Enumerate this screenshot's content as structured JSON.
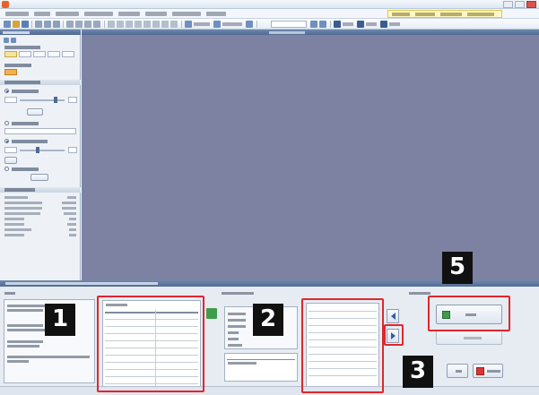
{
  "app": {
    "title": ""
  },
  "colors": {
    "viewer_background": "#7d82a3",
    "panel_header": "#4e6a94",
    "highlight": "#e0272b",
    "callout_background": "#111111",
    "help_box": "#fff7c9",
    "accent_orange": "#e8632b"
  },
  "icons": {
    "app_logo": "app-logo-icon",
    "arrow_left": "arrow-left-icon",
    "arrow_right": "arrow-right-icon",
    "ok_button_icon": "green-square-icon",
    "cancel_button_icon": "red-x-icon"
  },
  "callouts": [
    {
      "id": "1",
      "label": "1"
    },
    {
      "id": "2",
      "label": "2"
    },
    {
      "id": "3",
      "label": "3"
    },
    {
      "id": "5",
      "label": "5"
    }
  ]
}
